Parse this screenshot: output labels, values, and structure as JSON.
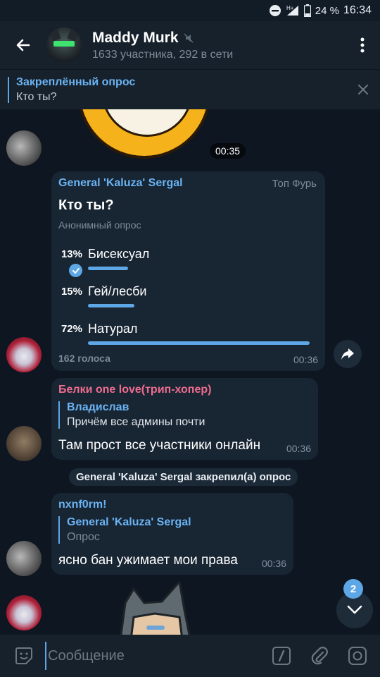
{
  "status_bar": {
    "battery": "24 %",
    "clock": "16:34",
    "network": "H+",
    "icons": [
      "dnd-icon",
      "signal-icon",
      "battery-icon"
    ]
  },
  "header": {
    "title": "Maddy Murk",
    "subtitle": "1633 участника, 292 в сети",
    "icons": [
      "back-arrow-icon",
      "muted-icon",
      "more-vert-icon"
    ]
  },
  "pinned": {
    "title": "Закреплённый опрос",
    "text": "Кто ты?"
  },
  "messages": {
    "sticker1_time": "00:35",
    "poll": {
      "author": "General 'Kaluza' Sergal",
      "forward_from": "Топ Фурь",
      "question": "Кто ты?",
      "type": "Анонимный опрос",
      "options": [
        {
          "pct": "13%",
          "label": "Бисексуал",
          "value": 13,
          "chosen": true
        },
        {
          "pct": "15%",
          "label": "Гей/лесби",
          "value": 15,
          "chosen": false
        },
        {
          "pct": "72%",
          "label": "Натурал",
          "value": 72,
          "chosen": false
        }
      ],
      "votes": "162 голоса",
      "time": "00:36"
    },
    "msg2": {
      "author": "Белки one love(трип-хопер)",
      "reply_name": "Владислав",
      "reply_text": "Причём все админы почти",
      "text": "Там прост все участники онлайн",
      "time": "00:36"
    },
    "service": "General 'Kaluza' Sergal закрепил(а) опрос",
    "msg3": {
      "author": "nxnf0rm!",
      "reply_name": "General 'Kaluza' Sergal",
      "reply_text": "Опрос",
      "text": "ясно бан ужимает мои права",
      "time": "00:36"
    },
    "unread_count": "2"
  },
  "input": {
    "placeholder": "Сообщение"
  },
  "colors": {
    "accent": "#5ea7e6",
    "background": "#0e1621",
    "bubble": "#182533",
    "name_pink": "#ee6d8f",
    "name_blue": "#6ab3f3"
  }
}
